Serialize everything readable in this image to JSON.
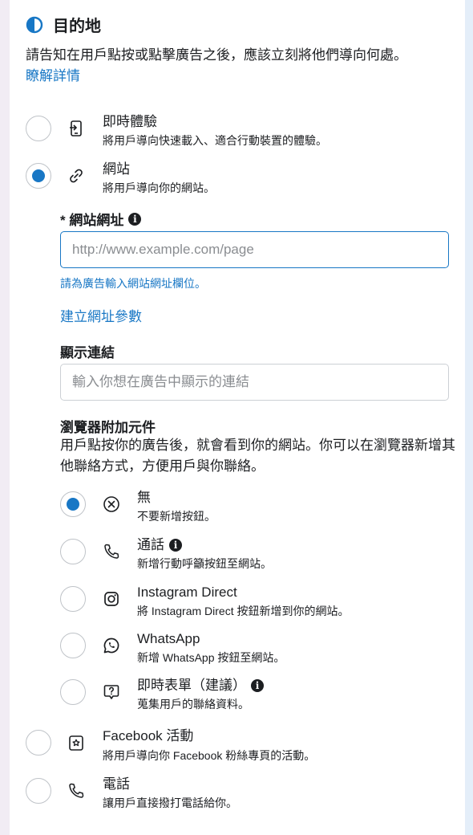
{
  "header": {
    "title": "目的地",
    "description": "請告知在用戶點按或點擊廣告之後，應該立刻將他們導向何處。",
    "learn_more": "瞭解詳情"
  },
  "destinations": [
    {
      "title": "即時體驗",
      "subtitle": "將用戶導向快速載入、適合行動裝置的體驗。",
      "icon": "instant-experience-icon",
      "selected": false
    },
    {
      "title": "網站",
      "subtitle": "將用戶導向你的網站。",
      "icon": "link-icon",
      "selected": true
    },
    {
      "title": "Facebook 活動",
      "subtitle": "將用戶導向你 Facebook 粉絲專頁的活動。",
      "icon": "event-icon",
      "selected": false
    },
    {
      "title": "電話",
      "subtitle": "讓用戶直接撥打電話給你。",
      "icon": "phone-icon",
      "selected": false
    }
  ],
  "website": {
    "url_label": "* 網站網址",
    "url_placeholder": "http://www.example.com/page",
    "url_error": "請為廣告輸入網站網址欄位。",
    "build_params": "建立網址參數",
    "display_link_label": "顯示連結",
    "display_link_placeholder": "輸入你想在廣告中顯示的連結"
  },
  "browser_addons": {
    "title": "瀏覽器附加元件",
    "description": "用戶點按你的廣告後，就會看到你的網站。你可以在瀏覽器新增其他聯絡方式，方便用戶與你聯絡。",
    "options": [
      {
        "title": "無",
        "subtitle": "不要新增按鈕。",
        "icon": "none-icon",
        "selected": true,
        "info": false
      },
      {
        "title": "通話",
        "subtitle": "新增行動呼籲按鈕至網站。",
        "icon": "phone-icon",
        "selected": false,
        "info": true
      },
      {
        "title": "Instagram Direct",
        "subtitle": "將 Instagram Direct 按鈕新增到你的網站。",
        "icon": "instagram-icon",
        "selected": false,
        "info": false
      },
      {
        "title": "WhatsApp",
        "subtitle": "新增 WhatsApp 按鈕至網站。",
        "icon": "whatsapp-icon",
        "selected": false,
        "info": false
      },
      {
        "title": "即時表單（建議）",
        "subtitle": "蒐集用戶的聯絡資料。",
        "icon": "form-icon",
        "selected": false,
        "info": true
      }
    ]
  },
  "info_glyph": "i",
  "colors": {
    "accent": "#1877c5",
    "text": "#1c1e21",
    "border": "#ccd0d5"
  }
}
